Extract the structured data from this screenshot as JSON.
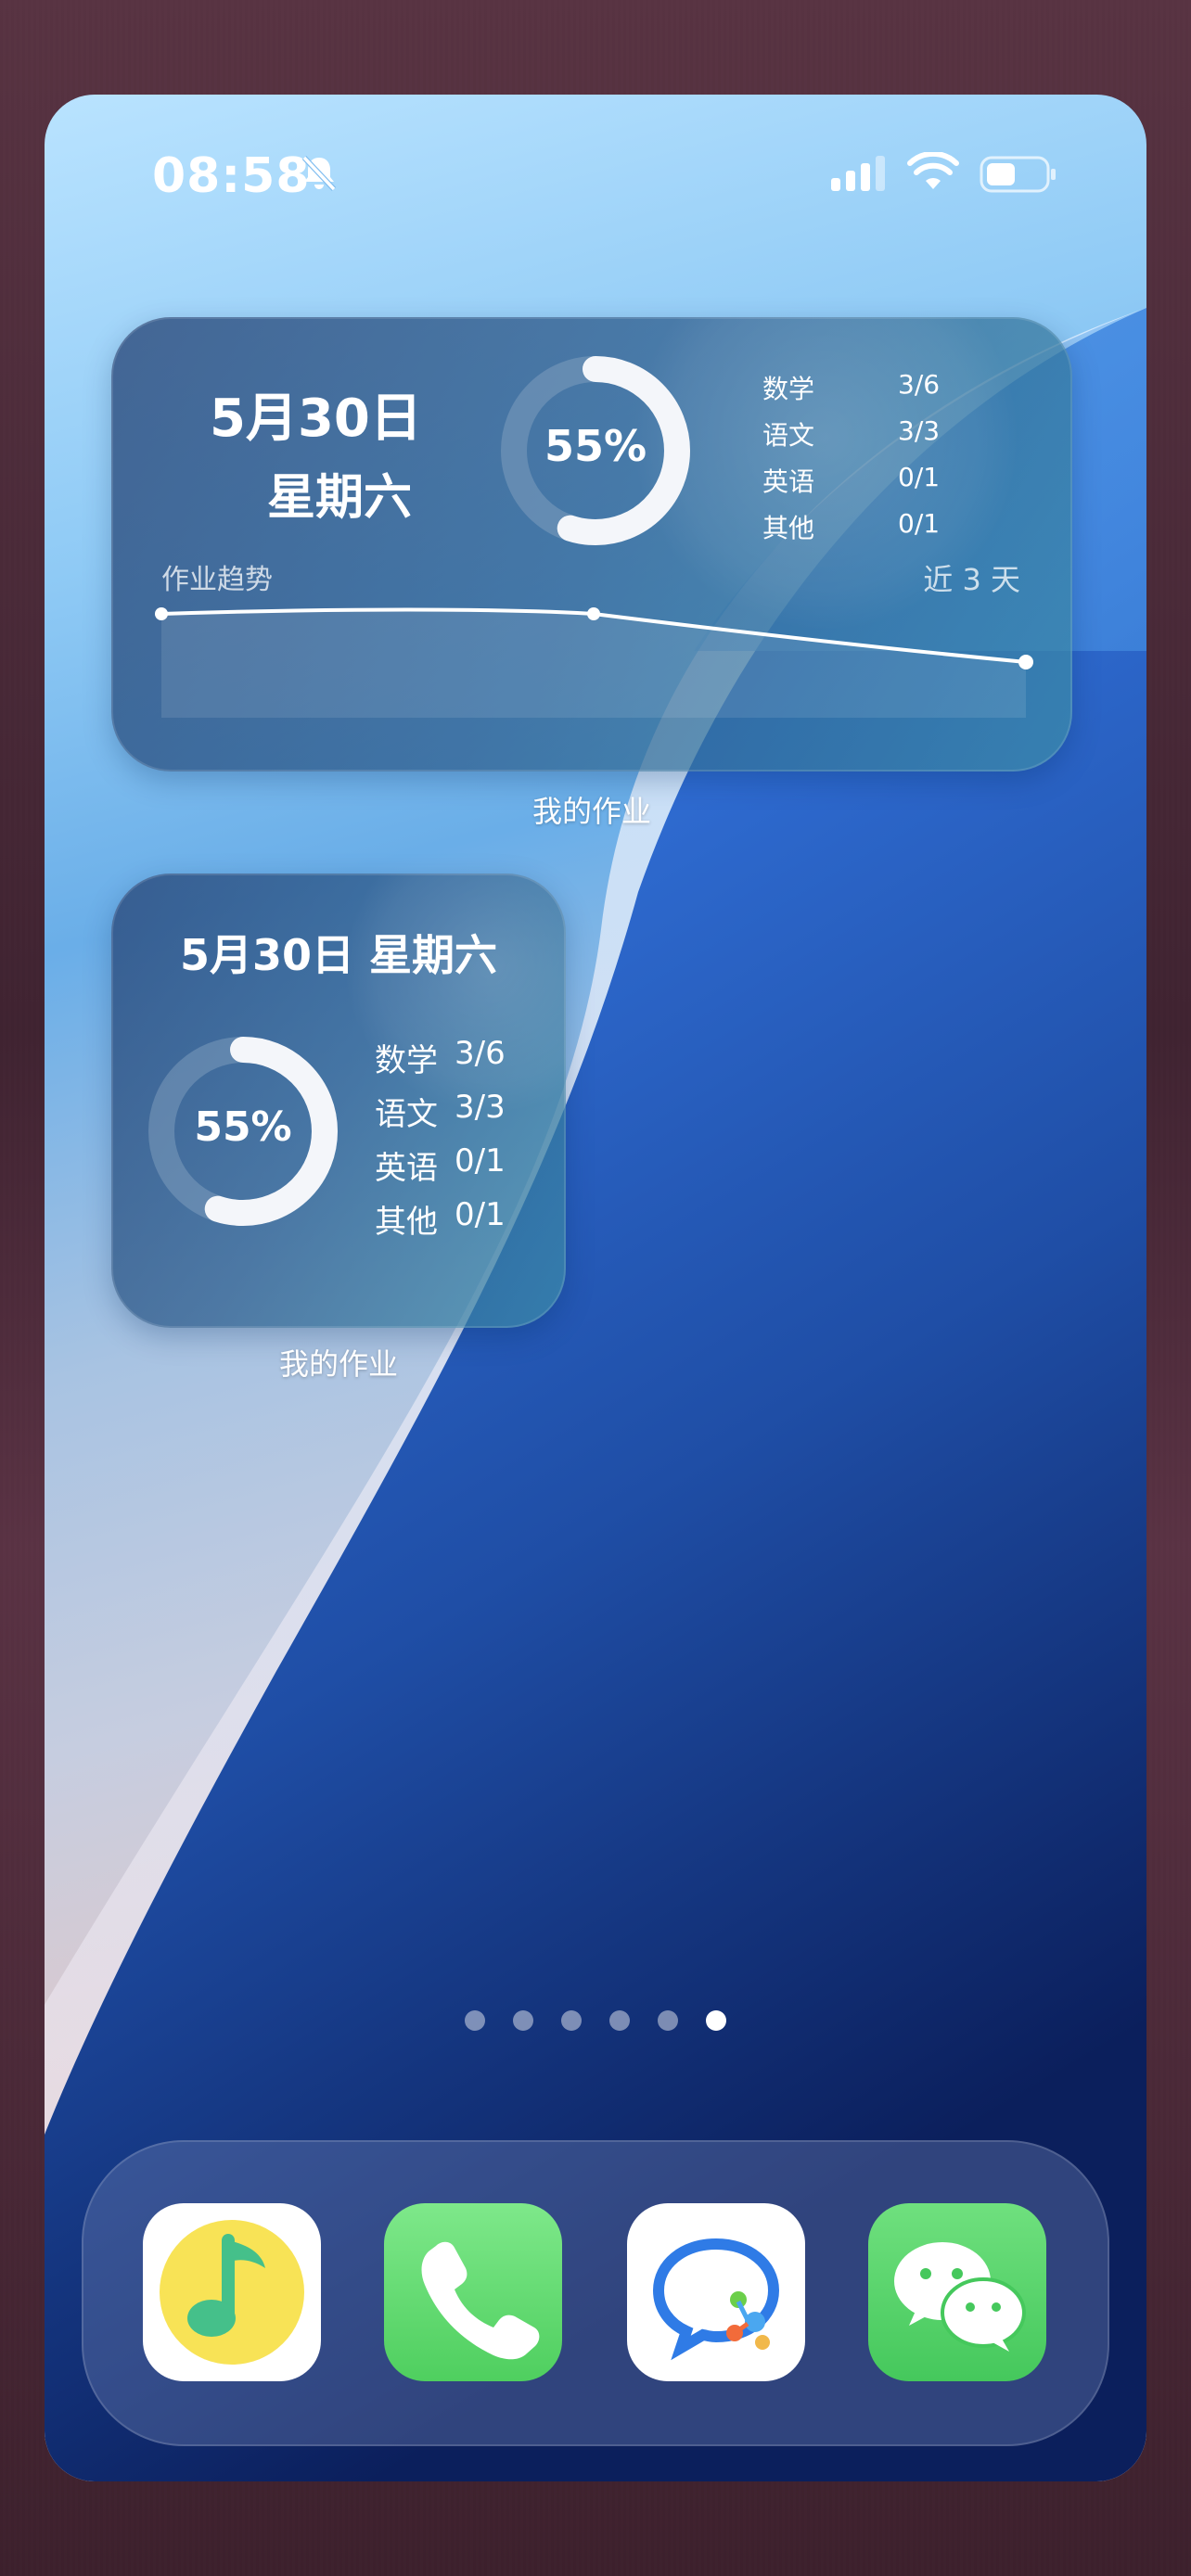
{
  "status_bar": {
    "time": "08:58",
    "icons": [
      "bell-slash-icon",
      "cellular-signal-icon",
      "wifi-icon",
      "battery-icon"
    ]
  },
  "widget_large": {
    "date": "5月30日",
    "weekday": "星期六",
    "percent": "55%",
    "progress": 0.55,
    "subjects": [
      {
        "name": "数学",
        "value": "3/6"
      },
      {
        "name": "语文",
        "value": "3/3"
      },
      {
        "name": "英语",
        "value": "0/1"
      },
      {
        "name": "其他",
        "value": "0/1"
      }
    ],
    "trend_label": "作业趋势",
    "trend_range": "近 3 天",
    "app_label": "我的作业"
  },
  "widget_small": {
    "date_weekday": "5月30日 星期六",
    "percent": "55%",
    "progress": 0.55,
    "subjects": [
      {
        "name": "数学",
        "value": "3/6"
      },
      {
        "name": "语文",
        "value": "3/3"
      },
      {
        "name": "英语",
        "value": "0/1"
      },
      {
        "name": "其他",
        "value": "0/1"
      }
    ],
    "app_label": "我的作业"
  },
  "page_dots": {
    "count": 6,
    "active_index": 5
  },
  "dock": {
    "apps": [
      {
        "name": "qq-music-icon"
      },
      {
        "name": "phone-icon"
      },
      {
        "name": "dingtalk-style-chat-icon"
      },
      {
        "name": "wechat-icon"
      }
    ]
  },
  "colors": {
    "ring_track": "#8aa6c4",
    "ring_fill": "#f4f6fa",
    "phone_green": "#5ed36a",
    "wechat_green": "#4fd26b",
    "music_yellow": "#f8e356"
  }
}
